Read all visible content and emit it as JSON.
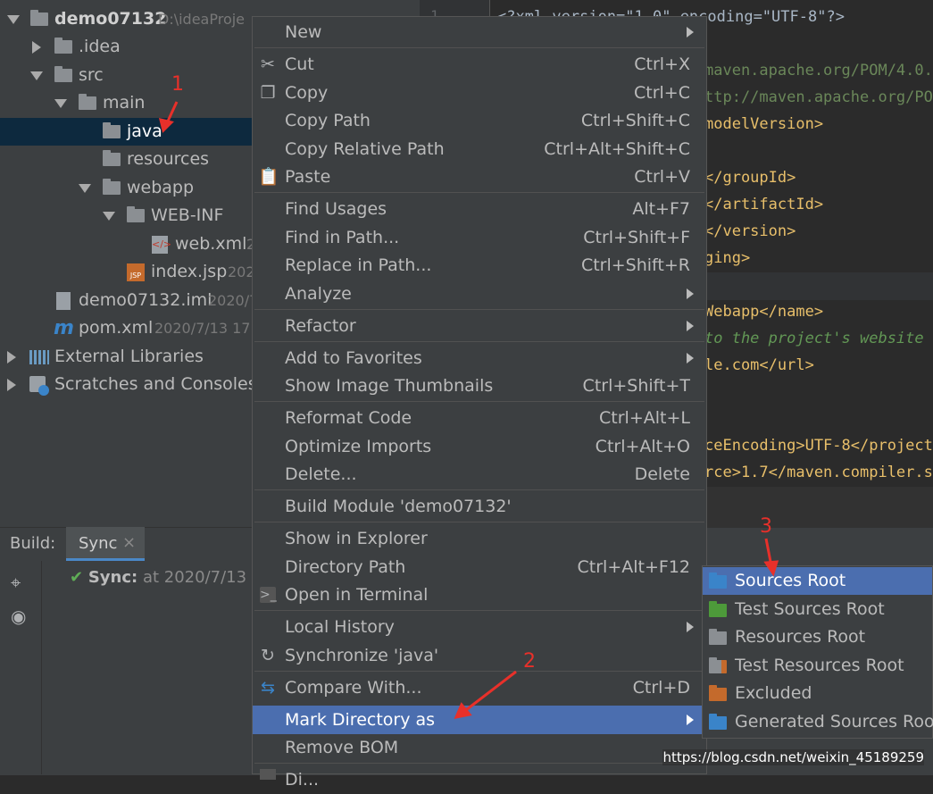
{
  "project_tree": {
    "root": {
      "name": "demo07132",
      "path": "D:\\ideaProje..."
    },
    "items": [
      {
        "label": "demo07132",
        "extra": "D:\\ideaProje"
      },
      {
        "label": ".idea"
      },
      {
        "label": "src"
      },
      {
        "label": "main"
      },
      {
        "label": "java"
      },
      {
        "label": "resources"
      },
      {
        "label": "webapp"
      },
      {
        "label": "WEB-INF"
      },
      {
        "label": "web.xml",
        "extra": "2"
      },
      {
        "label": "index.jsp",
        "extra": "202"
      },
      {
        "label": "demo07132.iml",
        "extra": "2020/7"
      },
      {
        "label": "pom.xml",
        "extra": "2020/7/13 17:4"
      },
      {
        "label": "External Libraries"
      },
      {
        "label": "Scratches and Consoles"
      }
    ]
  },
  "editor": {
    "gutter_number": "1",
    "lines": [
      "<?xml version=\"1.0\" encoding=\"UTF-8\"?>",
      "maven.apache.org/POM/4.0.0",
      "ttp://maven.apache.org/POM",
      "modelVersion>",
      "</groupId>",
      "</artifactId>",
      "</version>",
      "ging>",
      "Webapp</name>",
      "to the project's website -",
      "le.com</url>",
      "ceEncoding>UTF-8</project.",
      "rce>1.7</maven.compiler.so"
    ]
  },
  "build_panel": {
    "label": "Build:",
    "tab": "Sync",
    "close": "×",
    "status_label": "Sync:",
    "status_text": "at 2020/7/13 1"
  },
  "context_menu": {
    "items": [
      {
        "label": "New",
        "shortcut": ""
      },
      {
        "label": "Cut",
        "shortcut": "Ctrl+X"
      },
      {
        "label": "Copy",
        "shortcut": "Ctrl+C"
      },
      {
        "label": "Copy Path",
        "shortcut": "Ctrl+Shift+C"
      },
      {
        "label": "Copy Relative Path",
        "shortcut": "Ctrl+Alt+Shift+C"
      },
      {
        "label": "Paste",
        "shortcut": "Ctrl+V"
      },
      {
        "label": "Find Usages",
        "shortcut": "Alt+F7"
      },
      {
        "label": "Find in Path...",
        "shortcut": "Ctrl+Shift+F"
      },
      {
        "label": "Replace in Path...",
        "shortcut": "Ctrl+Shift+R"
      },
      {
        "label": "Analyze",
        "shortcut": ""
      },
      {
        "label": "Refactor",
        "shortcut": ""
      },
      {
        "label": "Add to Favorites",
        "shortcut": ""
      },
      {
        "label": "Show Image Thumbnails",
        "shortcut": "Ctrl+Shift+T"
      },
      {
        "label": "Reformat Code",
        "shortcut": "Ctrl+Alt+L"
      },
      {
        "label": "Optimize Imports",
        "shortcut": "Ctrl+Alt+O"
      },
      {
        "label": "Delete...",
        "shortcut": "Delete"
      },
      {
        "label": "Build Module 'demo07132'",
        "shortcut": ""
      },
      {
        "label": "Show in Explorer",
        "shortcut": ""
      },
      {
        "label": "Directory Path",
        "shortcut": "Ctrl+Alt+F12"
      },
      {
        "label": "Open in Terminal",
        "shortcut": ""
      },
      {
        "label": "Local History",
        "shortcut": ""
      },
      {
        "label": "Synchronize 'java'",
        "shortcut": ""
      },
      {
        "label": "Compare With...",
        "shortcut": "Ctrl+D"
      },
      {
        "label": "Mark Directory as",
        "shortcut": ""
      },
      {
        "label": "Remove BOM",
        "shortcut": ""
      },
      {
        "label": "Di...",
        "shortcut": ""
      }
    ]
  },
  "submenu": {
    "items": [
      {
        "label": "Sources Root"
      },
      {
        "label": "Test Sources Root"
      },
      {
        "label": "Resources Root"
      },
      {
        "label": "Test Resources Root"
      },
      {
        "label": "Excluded"
      },
      {
        "label": "Generated Sources Root"
      }
    ]
  },
  "annotations": [
    "1",
    "2",
    "3"
  ],
  "watermark": "https://blog.csdn.net/weixin_45189259",
  "colors": {
    "highlight": "#4b6eaf",
    "selection": "#0d293e",
    "annotation": "#e8302a"
  }
}
